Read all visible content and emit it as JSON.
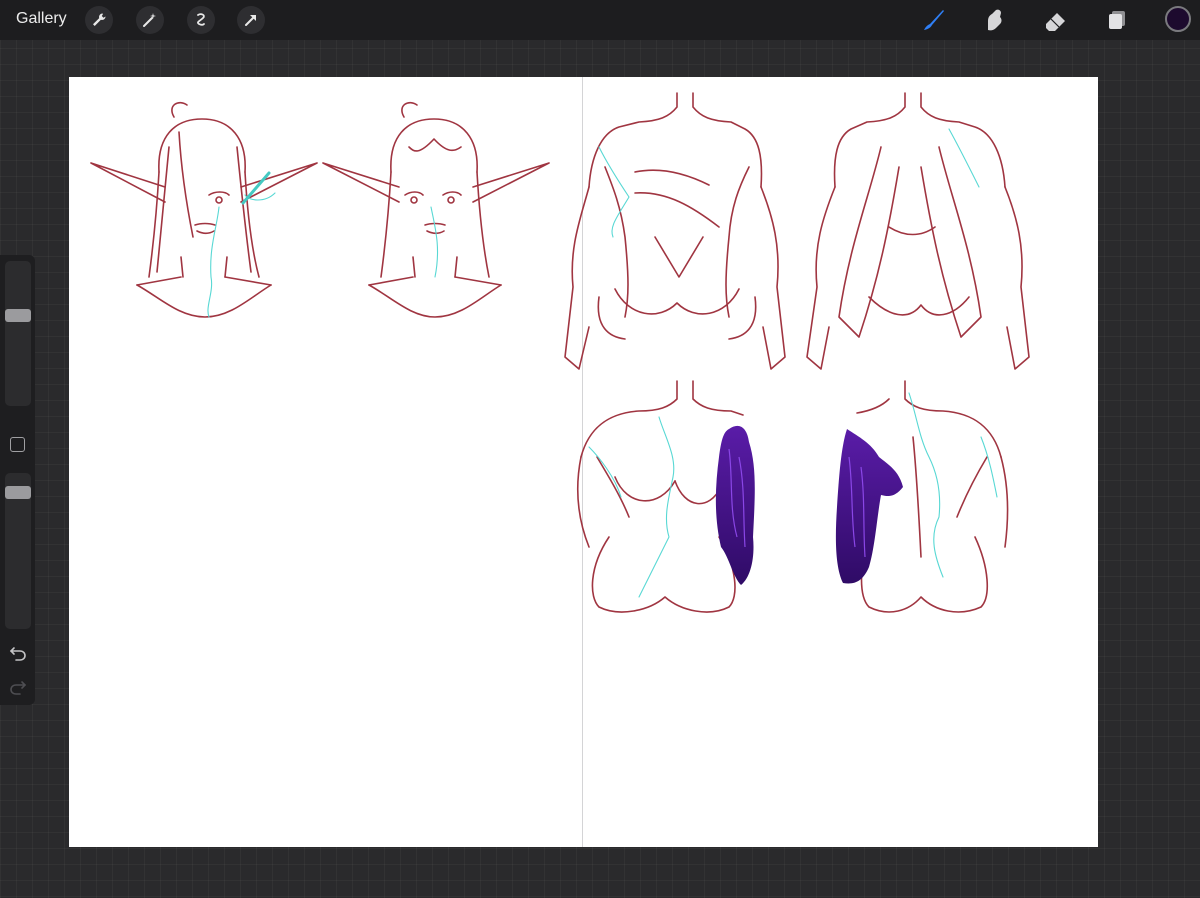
{
  "topbar": {
    "gallery_label": "Gallery",
    "left_tools": [
      "wrench-icon",
      "magic-wand-icon",
      "selection-icon",
      "transform-arrow-icon"
    ],
    "right_tools": [
      "brush-icon",
      "smudge-icon",
      "eraser-icon",
      "layers-icon"
    ],
    "active_tool": "brush-icon",
    "active_color": "#1d0a2e",
    "accent_color": "#2f7ff5"
  },
  "sidebar": {
    "size_slider_value": 0.36,
    "opacity_slider_value": 0.09
  },
  "canvas": {
    "background": "#ffffff",
    "sketch_color": "#a03541",
    "vein_color": "#58d8d4",
    "fill_color": "#4a1592"
  }
}
